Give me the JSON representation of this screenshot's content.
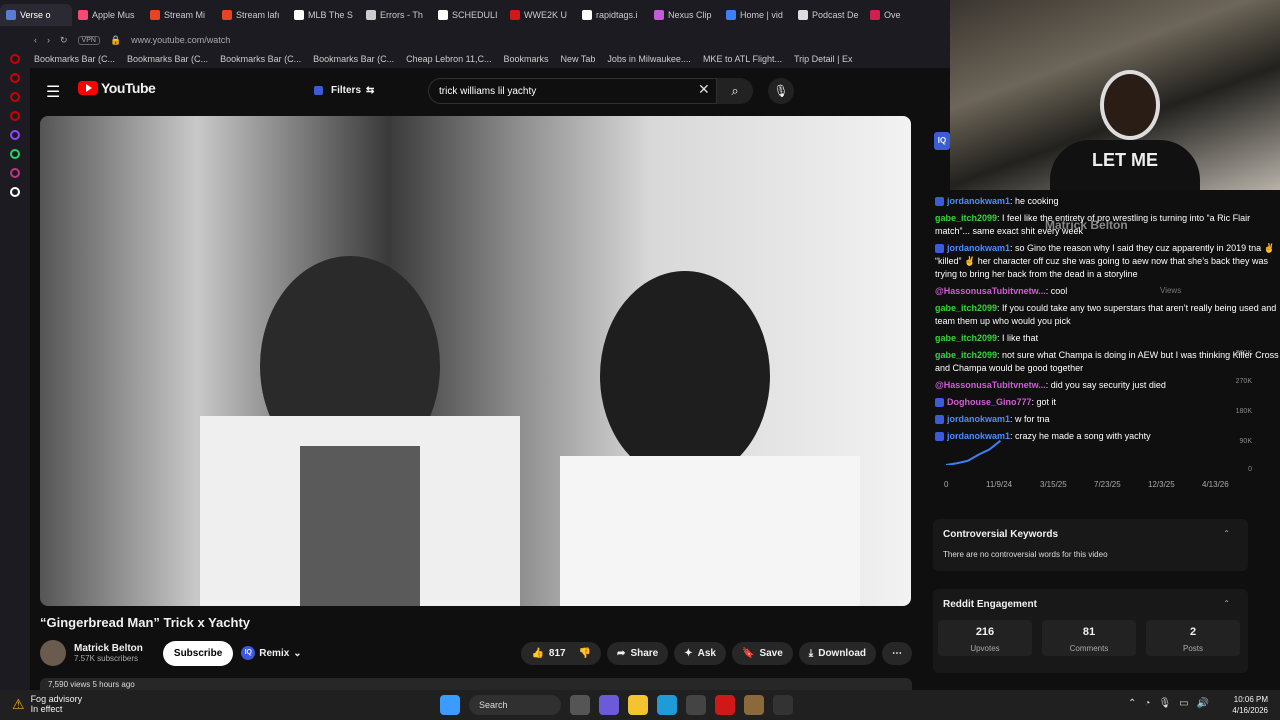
{
  "browser": {
    "tabs": [
      {
        "label": "Verse o",
        "color": "#5a7bd8"
      },
      {
        "label": "Apple Mus",
        "color": "#f64a73"
      },
      {
        "label": "Stream Mi",
        "color": "#e6451f"
      },
      {
        "label": "Stream lafı",
        "color": "#e6451f"
      },
      {
        "label": "MLB The S",
        "color": "#ffffff"
      },
      {
        "label": "Errors - Th",
        "color": "#cccccc"
      },
      {
        "label": "SCHEDULI",
        "color": "#ffffff"
      },
      {
        "label": "WWE2K U",
        "color": "#d01818"
      },
      {
        "label": "rapidtags.i",
        "color": "#ffffff"
      },
      {
        "label": "Nexus Clip",
        "color": "#c45bd8"
      },
      {
        "label": "Home | vid",
        "color": "#3b82f6"
      },
      {
        "label": "Podcast De",
        "color": "#dddddd"
      },
      {
        "label": "Ove",
        "color": "#d02050"
      }
    ],
    "vpn": "VPN",
    "url": "www.youtube.com/watch",
    "bookmarks": [
      "Bookmarks Bar (C...",
      "Bookmarks Bar (C...",
      "Bookmarks Bar (C...",
      "Bookmarks Bar (C...",
      "Cheap Lebron 11,C...",
      "Bookmarks",
      "New Tab",
      "Jobs in Milwaukee....",
      "MKE to ATL Flight...",
      "Trip Detail | Ex"
    ]
  },
  "youtube": {
    "logo": "YouTube",
    "filters": "Filters",
    "search_value": "trick williams lil yachty",
    "video_title": "“Gingerbread Man” Trick x Yachty",
    "channel": "Matrick Belton",
    "subscribers": "7.57K subscribers",
    "subscribe": "Subscribe",
    "remix": "Remix",
    "likes": "817",
    "share": "Share",
    "ask": "Ask",
    "save": "Save",
    "download": "Download",
    "desc_preview": "7,590 views  5 hours ago"
  },
  "chat": [
    {
      "user": "jordanokwam1",
      "color": "b",
      "chip": true,
      "text": ": he cooking"
    },
    {
      "user": "gabe_itch2099",
      "color": "g",
      "chip": false,
      "text": ": I feel like the entirety of pro wrestling is turning into “a Ric Flair match”... same exact shit every week"
    },
    {
      "user": "jordanokwam1",
      "color": "b",
      "chip": true,
      "text": ": so Gino the reason why I said they cuz apparently in 2019 tna ✌ “killed” ✌ her character off cuz she was going to aew now that she’s back they was trying to bring her back from the dead in a storyline"
    },
    {
      "user": "@HassonusaTubitvnetw...",
      "color": "p",
      "chip": false,
      "text": ": cool"
    },
    {
      "user": "gabe_itch2099",
      "color": "g",
      "chip": false,
      "text": ": If you could take any two superstars that aren’t really being used and team them up who would you pick"
    },
    {
      "user": "gabe_itch2099",
      "color": "g",
      "chip": false,
      "text": ": I like that"
    },
    {
      "user": "gabe_itch2099",
      "color": "g",
      "chip": false,
      "text": ": not sure what Champa is doing in AEW but I was thinking Killer Cross and Champa would be good together"
    },
    {
      "user": "@HassonusaTubitvnetw...",
      "color": "p",
      "chip": false,
      "text": ": did you say security just died"
    },
    {
      "user": "Doghouse_Gino777",
      "color": "p",
      "chip": true,
      "text": ": got it"
    },
    {
      "user": "jordanokwam1",
      "color": "b",
      "chip": true,
      "text": ": w for tna"
    },
    {
      "user": "jordanokwam1",
      "color": "b",
      "chip": true,
      "text": ": crazy he made a song with yachty"
    }
  ],
  "overlay": {
    "channel_name": "Matrick Belton",
    "views_label": "Views"
  },
  "chart_data": {
    "type": "line",
    "title": "",
    "x_ticks": [
      "0",
      "11/9/24",
      "3/15/25",
      "7/23/25",
      "12/3/25",
      "4/13/26"
    ],
    "y_ticks": [
      "360K",
      "270K",
      "180K",
      "90K",
      "0"
    ],
    "series": [
      {
        "values": [
          0,
          5000,
          12000,
          30000,
          45000,
          70000
        ]
      }
    ]
  },
  "panels": {
    "controversial_title": "Controversial Keywords",
    "controversial_text": "There are no controversial words for this video",
    "reddit_title": "Reddit Engagement",
    "stats": [
      {
        "value": "216",
        "label": "Upvotes"
      },
      {
        "value": "81",
        "label": "Comments"
      },
      {
        "value": "2",
        "label": "Posts"
      }
    ]
  },
  "taskbar": {
    "weather_title": "Fog advisory",
    "weather_sub": "In effect",
    "search": "Search",
    "time": "10:06 PM",
    "date": "4/16/2026"
  }
}
